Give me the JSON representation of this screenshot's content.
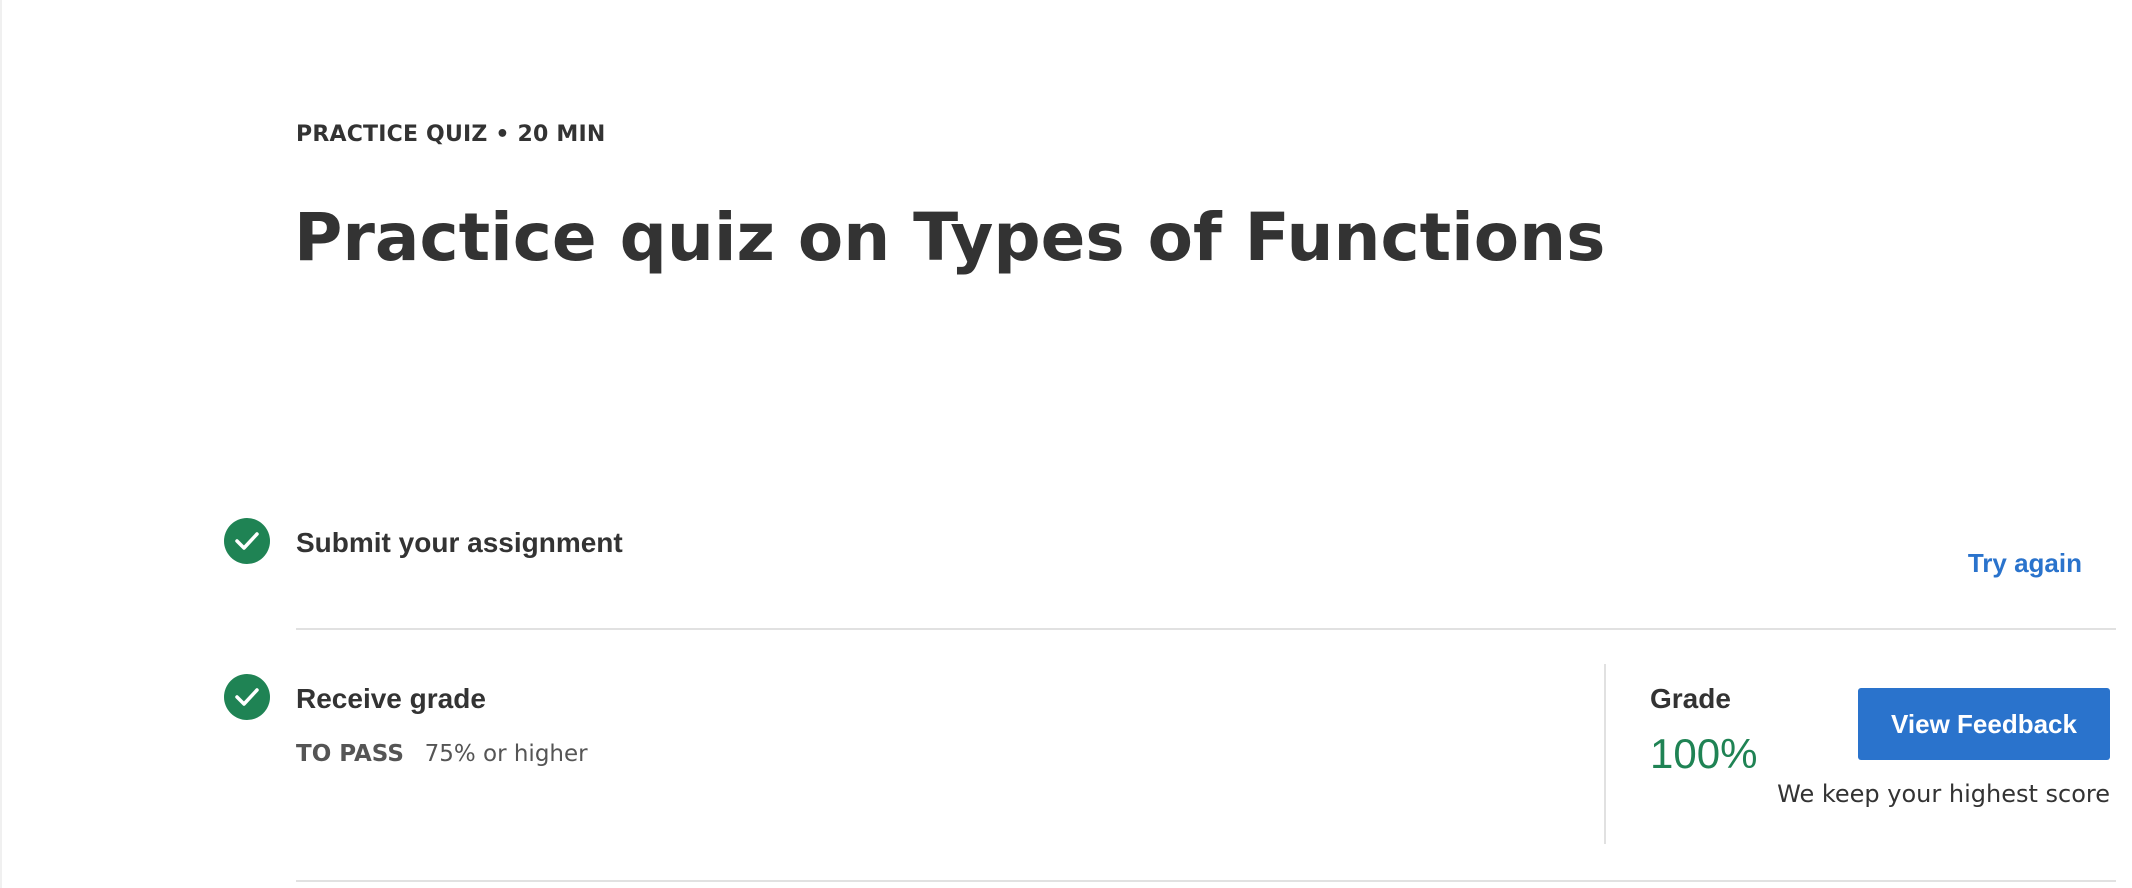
{
  "header": {
    "eyebrow": "PRACTICE QUIZ • 20 MIN",
    "title": "Practice quiz on Types of Functions"
  },
  "steps": [
    {
      "title": "Submit your assignment",
      "status": "complete",
      "icon": "check-circle-icon",
      "action_label": "Try again"
    },
    {
      "title": "Receive grade",
      "status": "complete",
      "icon": "check-circle-icon",
      "pass_label": "TO PASS",
      "pass_value": "75% or higher"
    }
  ],
  "grade": {
    "label": "Grade",
    "value": "100%",
    "button_label": "View Feedback",
    "note": "We keep your highest score"
  },
  "colors": {
    "success": "#1f8354",
    "link": "#2a73cc",
    "button_bg": "#2a73cc",
    "text": "#333333",
    "divider": "#e1e1e1"
  }
}
